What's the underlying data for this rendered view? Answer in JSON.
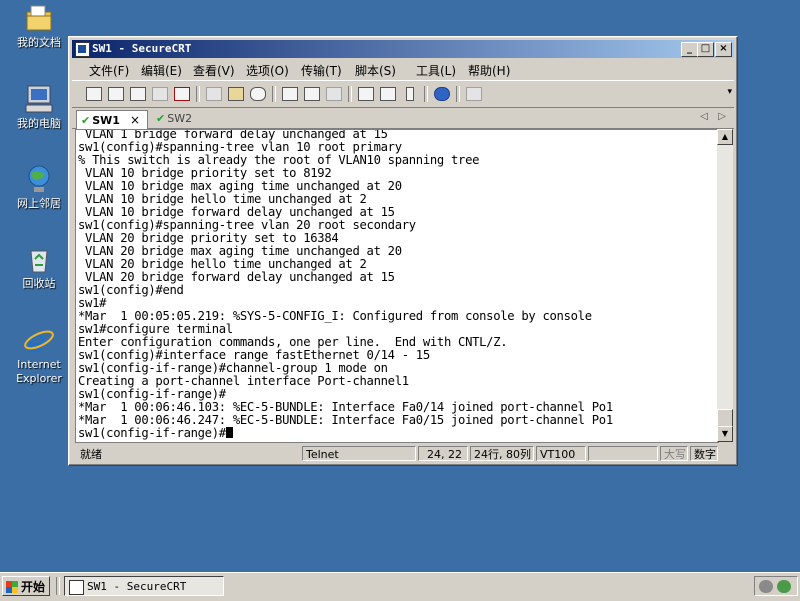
{
  "desktop": {
    "icons": [
      {
        "label": "我的文档",
        "icon": "my-documents-icon"
      },
      {
        "label": "我的电脑",
        "icon": "my-computer-icon"
      },
      {
        "label": "网上邻居",
        "icon": "network-places-icon"
      },
      {
        "label": "回收站",
        "icon": "recycle-bin-icon"
      },
      {
        "label": "Internet Explorer",
        "icon": "internet-explorer-icon"
      }
    ]
  },
  "window": {
    "title": "SW1 - SecureCRT",
    "menu": [
      "文件(F)",
      "编辑(E)",
      "查看(V)",
      "选项(O)",
      "传输(T)",
      "脚本(S)",
      "工具(L)",
      "帮助(H)"
    ],
    "tabs": [
      {
        "label": "SW1",
        "active": true
      },
      {
        "label": "SW2",
        "active": false
      }
    ],
    "terminal_lines": [
      " VLAN 1 bridge forward delay unchanged at 15",
      "sw1(config)#spanning-tree vlan 10 root primary",
      "% This switch is already the root of VLAN10 spanning tree",
      " VLAN 10 bridge priority set to 8192",
      " VLAN 10 bridge max aging time unchanged at 20",
      " VLAN 10 bridge hello time unchanged at 2",
      " VLAN 10 bridge forward delay unchanged at 15",
      "sw1(config)#spanning-tree vlan 20 root secondary",
      " VLAN 20 bridge priority set to 16384",
      " VLAN 20 bridge max aging time unchanged at 20",
      " VLAN 20 bridge hello time unchanged at 2",
      " VLAN 20 bridge forward delay unchanged at 15",
      "sw1(config)#end",
      "sw1#",
      "*Mar  1 00:05:05.219: %SYS-5-CONFIG_I: Configured from console by console",
      "sw1#configure terminal",
      "Enter configuration commands, one per line.  End with CNTL/Z.",
      "sw1(config)#interface range fastEthernet 0/14 - 15",
      "sw1(config-if-range)#channel-group 1 mode on",
      "Creating a port-channel interface Port-channel1",
      "sw1(config-if-range)#",
      "*Mar  1 00:06:46.103: %EC-5-BUNDLE: Interface Fa0/14 joined port-channel Po1",
      "*Mar  1 00:06:46.247: %EC-5-BUNDLE: Interface Fa0/15 joined port-channel Po1",
      "sw1(config-if-range)#"
    ],
    "status": {
      "ready": "就绪",
      "protocol": "Telnet",
      "cursor_pos": "24, 22",
      "size": "24行, 80列",
      "terminal_type": "VT100",
      "caps": "大写",
      "num": "数字"
    }
  },
  "taskbar": {
    "start_label": "开始",
    "task_title": "SW1 - SecureCRT"
  }
}
